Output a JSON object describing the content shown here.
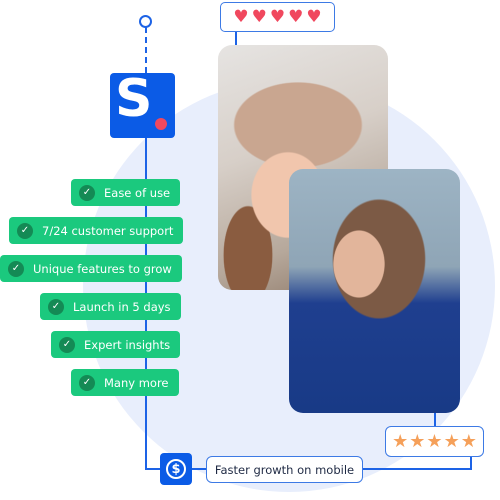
{
  "brand": {
    "logo_letter": "S",
    "logo_color": "#0b5be6",
    "accent_dot_color": "#f0485e"
  },
  "rating_hearts": {
    "icon": "heart-icon",
    "glyph": "♥",
    "count": 5,
    "color": "#f0485e"
  },
  "rating_stars": {
    "icon": "star-icon",
    "glyph": "★",
    "count": 5,
    "color": "#f5a05a"
  },
  "features": [
    {
      "label": "Ease of use"
    },
    {
      "label": "7/24 customer support"
    },
    {
      "label": "Unique features to grow"
    },
    {
      "label": "Launch in 5 days"
    },
    {
      "label": "Expert insights"
    },
    {
      "label": "Many more"
    }
  ],
  "check_glyph": "✓",
  "footer": {
    "dollar_icon": "dollar-icon",
    "dollar_glyph": "$",
    "label": "Faster growth on mobile"
  },
  "photos": [
    {
      "subject": "laughing woman in hat"
    },
    {
      "subject": "smiling woman with glasses"
    }
  ],
  "colors": {
    "primary": "#1d63e6",
    "feature_green": "#1bc97e",
    "circle_bg": "#e8eefc"
  }
}
